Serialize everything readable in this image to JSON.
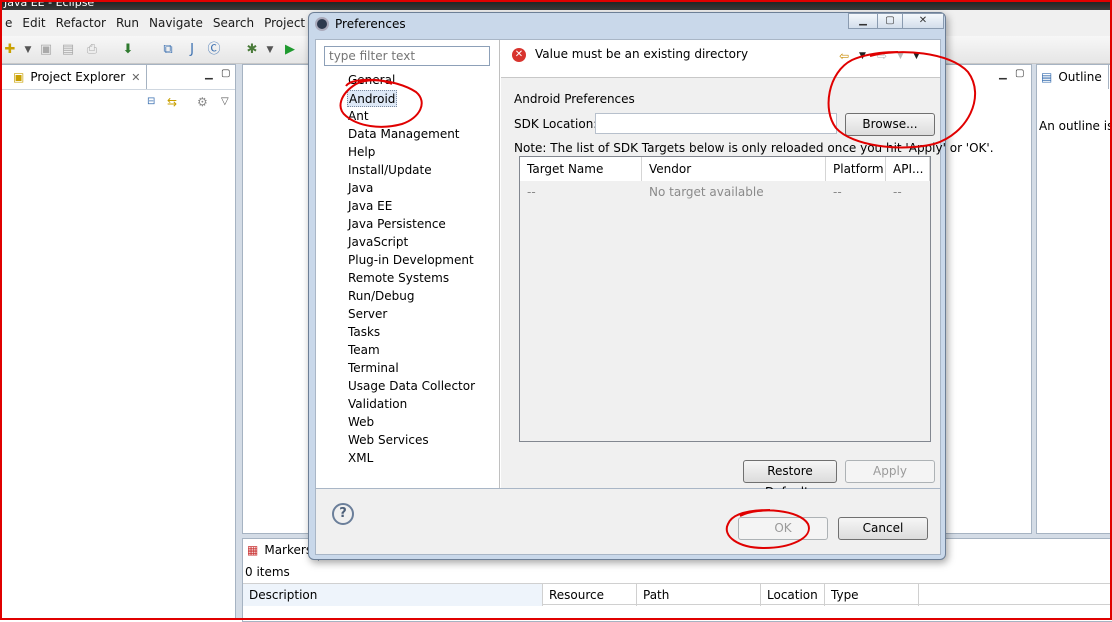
{
  "window": {
    "title": "Java EE - Eclipse"
  },
  "menu": [
    "e",
    "Edit",
    "Refactor",
    "Run",
    "Navigate",
    "Search",
    "Project"
  ],
  "views": {
    "project_explorer": {
      "title": "Project Explorer"
    },
    "outline": {
      "title": "Outline",
      "message": "An outline is n"
    },
    "markers": {
      "title": "Markers",
      "count_text": "0 items",
      "columns": [
        "Description",
        "Resource",
        "Path",
        "Location",
        "Type"
      ]
    }
  },
  "dialog": {
    "title": "Preferences",
    "filter_placeholder": "type filter text",
    "tree": [
      "General",
      "Android",
      "Ant",
      "Data Management",
      "Help",
      "Install/Update",
      "Java",
      "Java EE",
      "Java Persistence",
      "JavaScript",
      "Plug-in Development",
      "Remote Systems",
      "Run/Debug",
      "Server",
      "Tasks",
      "Team",
      "Terminal",
      "Usage Data Collector",
      "Validation",
      "Web",
      "Web Services",
      "XML"
    ],
    "selected_tree_item": "Android",
    "error_message": "Value must be an existing directory",
    "page": {
      "heading": "Android Preferences",
      "sdk_label": "SDK Location:",
      "sdk_value": "",
      "browse_button": "Browse...",
      "note": "Note: The list of SDK Targets below is only reloaded once you hit 'Apply' or 'OK'.",
      "table": {
        "columns": [
          "Target Name",
          "Vendor",
          "Platform",
          "API..."
        ],
        "rows": [
          [
            "--",
            "No target available",
            "--",
            "--"
          ]
        ]
      },
      "restore_defaults_button": "Restore Defaults",
      "apply_button": "Apply"
    },
    "ok_button": "OK",
    "cancel_button": "Cancel",
    "annotation_color": "#e00000"
  }
}
